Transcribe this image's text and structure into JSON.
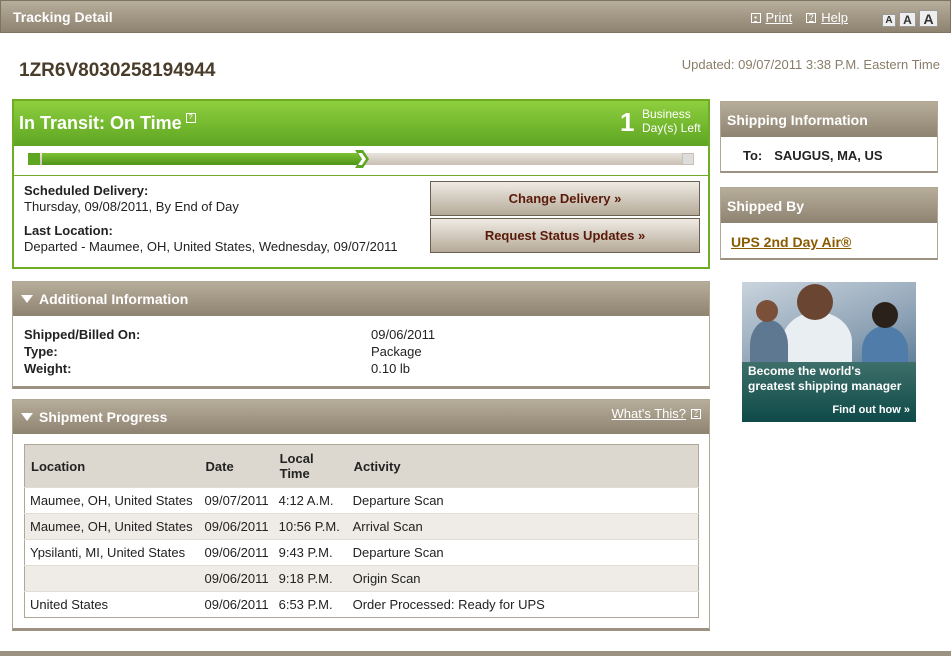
{
  "header": {
    "title": "Tracking Detail",
    "print_label": "Print",
    "help_label": "Help",
    "font_sizes": [
      "A",
      "A",
      "A"
    ]
  },
  "tracking": {
    "number": "1ZR6V8030258194944",
    "updated": "Updated: 09/07/2011 3:38 P.M. Eastern Time"
  },
  "status": {
    "title": "In Transit: On Time",
    "days_left": "1",
    "days_label_line1": "Business",
    "days_label_line2": "Day(s) Left",
    "progress_fraction": 0.5,
    "scheduled_label": "Scheduled Delivery:",
    "scheduled_value": "Thursday, 09/08/2011, By End of Day",
    "last_location_label": "Last Location:",
    "last_location_value": "Departed - Maumee, OH, United States, Wednesday, 09/07/2011",
    "change_delivery_label": "Change Delivery »",
    "request_updates_label": "Request Status Updates »",
    "accent_color": "#6fae24"
  },
  "additional_info": {
    "title": "Additional Information",
    "rows": [
      {
        "label": "Shipped/Billed On:",
        "value": "09/06/2011"
      },
      {
        "label": "Type:",
        "value": "Package"
      },
      {
        "label": "Weight:",
        "value": "0.10 lb"
      }
    ]
  },
  "shipment_progress": {
    "title": "Shipment Progress",
    "whats_this": "What's This?",
    "columns": [
      "Location",
      "Date",
      "Local Time",
      "Activity"
    ],
    "rows": [
      {
        "location": "Maumee, OH, United States",
        "date": "09/07/2011",
        "time": "4:12 A.M.",
        "activity": "Departure Scan"
      },
      {
        "location": "Maumee, OH, United States",
        "date": "09/06/2011",
        "time": "10:56 P.M.",
        "activity": "Arrival Scan"
      },
      {
        "location": "Ypsilanti, MI, United States",
        "date": "09/06/2011",
        "time": "9:43 P.M.",
        "activity": "Departure Scan"
      },
      {
        "location": "",
        "date": "09/06/2011",
        "time": "9:18 P.M.",
        "activity": "Origin Scan"
      },
      {
        "location": "United States",
        "date": "09/06/2011",
        "time": "6:53 P.M.",
        "activity": "Order Processed: Ready for UPS"
      }
    ]
  },
  "shipping_information": {
    "title": "Shipping Information",
    "to_label": "To:",
    "to_value": "SAUGUS, MA, US"
  },
  "shipped_by": {
    "title": "Shipped By",
    "service": "UPS 2nd Day Air®"
  },
  "ad": {
    "line1": "Become the world's",
    "line2": "greatest shipping manager",
    "cta": "Find out how »"
  }
}
